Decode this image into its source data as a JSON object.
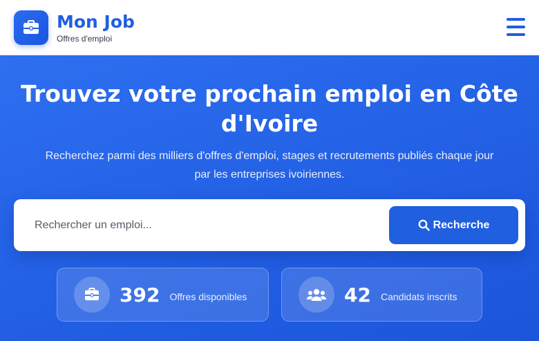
{
  "header": {
    "brand_title": "Mon Job",
    "brand_subtitle": "Offres d'emploi",
    "logo_icon": "briefcase-icon",
    "menu_icon": "hamburger-menu-icon",
    "accent_color": "#1f5fe0"
  },
  "hero": {
    "title": "Trouvez votre prochain emploi en Côte d'Ivoire",
    "subtitle": "Recherchez parmi des milliers d'offres d'emploi, stages et recrutements publiés chaque jour par les entreprises ivoiriennes."
  },
  "search": {
    "placeholder": "Rechercher un emploi...",
    "value": "",
    "button_label": "Recherche",
    "button_icon": "search-icon"
  },
  "stats": [
    {
      "value": "392",
      "label": "Offres disponibles",
      "icon": "briefcase-icon"
    },
    {
      "value": "42",
      "label": "Candidats inscrits",
      "icon": "users-icon"
    }
  ]
}
